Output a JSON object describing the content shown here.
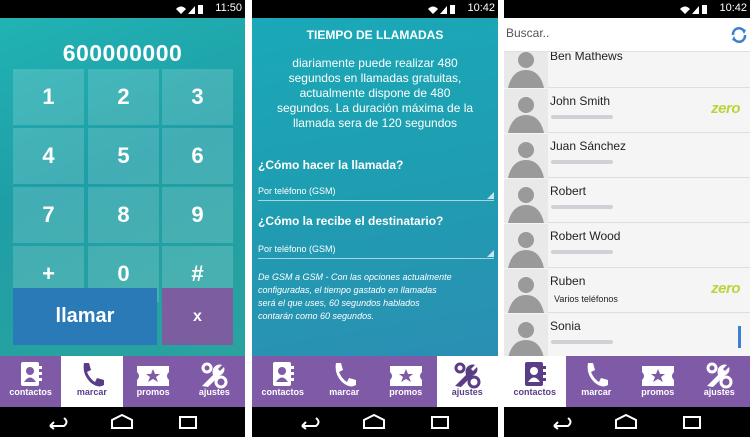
{
  "phone1": {
    "status_time": "11:50",
    "number": "600000000",
    "keys": [
      "1",
      "2",
      "3",
      "4",
      "5",
      "6",
      "7",
      "8",
      "9",
      "+",
      "0",
      "#"
    ],
    "call_label": "llamar",
    "delete_label": "x"
  },
  "phone2": {
    "status_time": "10:42",
    "title": "TIEMPO DE LLAMADAS",
    "description_lines": [
      "diariamente puede realizar 480",
      "segundos en llamadas gratuitas,",
      "actualmente dispone de 480",
      "segundos. La duración máxima de la",
      "llamada sera de 120 segundos"
    ],
    "q1_label": "¿Cómo hacer la llamada?",
    "q1_value": "Por teléfono (GSM)",
    "q2_label": "¿Cómo la recibe el destinatario?",
    "q2_value": "Por teléfono (GSM)",
    "note_lines": [
      "De GSM a GSM - Con las opciones actualmente",
      "configuradas, el tiempo gastado en llamadas",
      "será el que uses, 60 segundos hablados",
      "contarán como 60 segundos."
    ]
  },
  "phone3": {
    "status_time": "10:42",
    "search_placeholder": "Buscar..",
    "contacts": [
      {
        "name": "Ben Mathews",
        "sub": "",
        "zero": ""
      },
      {
        "name": "John Smith",
        "sub": "",
        "zero": "zero"
      },
      {
        "name": "Juan Sánchez",
        "sub": "",
        "zero": ""
      },
      {
        "name": "Robert",
        "sub": "",
        "zero": ""
      },
      {
        "name": "Robert Wood",
        "sub": "",
        "zero": ""
      },
      {
        "name": "Ruben",
        "sub": "Varios teléfonos",
        "zero": "zero"
      },
      {
        "name": "Sonia",
        "sub": "",
        "zero": ""
      }
    ]
  },
  "tabs": {
    "contactos": "contactos",
    "marcar": "marcar",
    "promos": "promos",
    "ajustes": "ajustes"
  },
  "icons": {
    "contactos": "contacts-book-icon",
    "marcar": "phone-handset-icon",
    "promos": "ticket-star-icon",
    "ajustes": "wrench-gear-icon"
  },
  "colors": {
    "teal": "#21b3b4",
    "purple_nav": "#7f5aa7",
    "call_blue": "#2a7ab8",
    "delete_purple": "#7c5ea0",
    "zero_green": "#bcd43c"
  }
}
